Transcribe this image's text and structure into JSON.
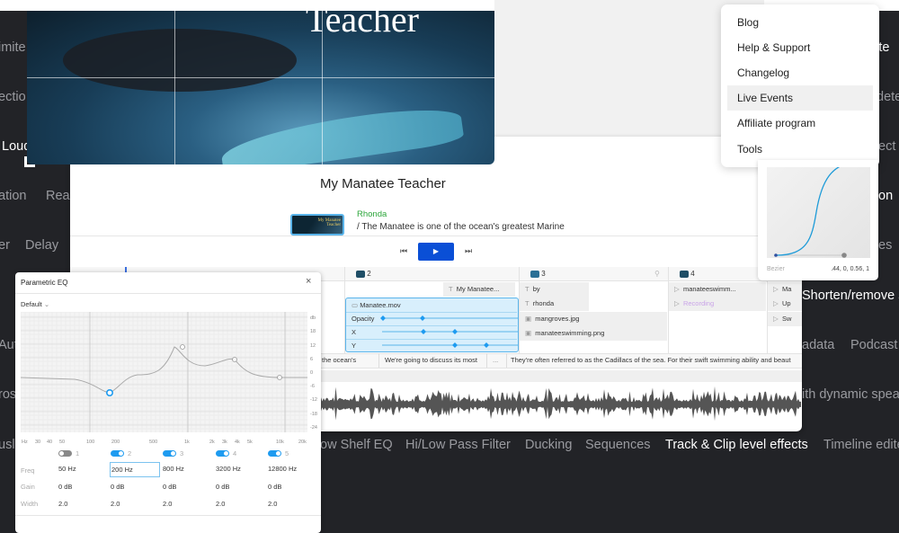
{
  "background_features": {
    "left": [
      "imite",
      "ectio",
      "Loud",
      "ation",
      "Real",
      "er",
      "Delay",
      "Aut",
      "ros",
      "usl"
    ],
    "right": [
      "edite",
      "dete",
      "ect",
      "on",
      "es",
      "Shorten/remove s",
      "adata",
      "Podcast",
      "ith dynamic spea",
      "Timeline edite"
    ],
    "bottom": [
      "ow Shelf EQ",
      "Hi/Low Pass Filter",
      "Ducking",
      "Sequences",
      "Track & Clip level effects"
    ]
  },
  "video": {
    "overlay_title": "Teacher"
  },
  "menu": {
    "items": [
      "Blog",
      "Help & Support",
      "Changelog",
      "Live Events",
      "Affiliate program",
      "Tools"
    ],
    "highlighted": "Live Events"
  },
  "bezier": {
    "label": "Bezier",
    "value": ".44, 0, 0.56, 1"
  },
  "app": {
    "project_title": "My Manatee Teacher",
    "thumbnail_text": "My Manatee Teacher",
    "speaker": "Rhonda",
    "transcript_line": "/ The Manatee is one of the ocean's greatest Marine",
    "accent": "#0a4fd6",
    "tracks": [
      {
        "number": "2",
        "clips": [
          "My Manatee...",
          "Manatee.mov"
        ],
        "keyframe_props": [
          "Opacity",
          "X",
          "Y"
        ]
      },
      {
        "number": "3",
        "clips": [
          "by",
          "rhonda",
          "mangroves.jpg",
          "manateeswimming.png"
        ]
      },
      {
        "number": "4",
        "clips": [
          "manateeswimm...",
          "Recording"
        ]
      },
      {
        "clips": [
          "Ma",
          "Up",
          "Sw"
        ]
      }
    ],
    "captions": [
      "the ocean's",
      "We're going to discuss its most",
      "...",
      "They're often referred to as the Cadillacs of the sea. For their swift swimming ability and beaut"
    ]
  },
  "eq": {
    "title": "Parametric EQ",
    "preset": "Default",
    "db_labels": [
      "db",
      "18",
      "12",
      "6",
      "0",
      "-6",
      "-12",
      "-18",
      "-24"
    ],
    "freq_labels": [
      "Hz",
      "30",
      "40",
      "50",
      "100",
      "200",
      "500",
      "1k",
      "2k",
      "3k",
      "4k",
      "5k",
      "10k",
      "20k"
    ],
    "row_labels": [
      "Freq",
      "Gain",
      "Width"
    ],
    "bands": [
      {
        "n": "1",
        "on": false,
        "freq": "50 Hz",
        "gain": "0 dB",
        "width": "2.0"
      },
      {
        "n": "2",
        "on": true,
        "freq": "200 Hz",
        "gain": "0 dB",
        "width": "2.0",
        "selected": true
      },
      {
        "n": "3",
        "on": true,
        "freq": "800 Hz",
        "gain": "0 dB",
        "width": "2.0"
      },
      {
        "n": "4",
        "on": true,
        "freq": "3200 Hz",
        "gain": "0 dB",
        "width": "2.0"
      },
      {
        "n": "5",
        "on": true,
        "freq": "12800 Hz",
        "gain": "0 dB",
        "width": "2.0"
      }
    ]
  }
}
